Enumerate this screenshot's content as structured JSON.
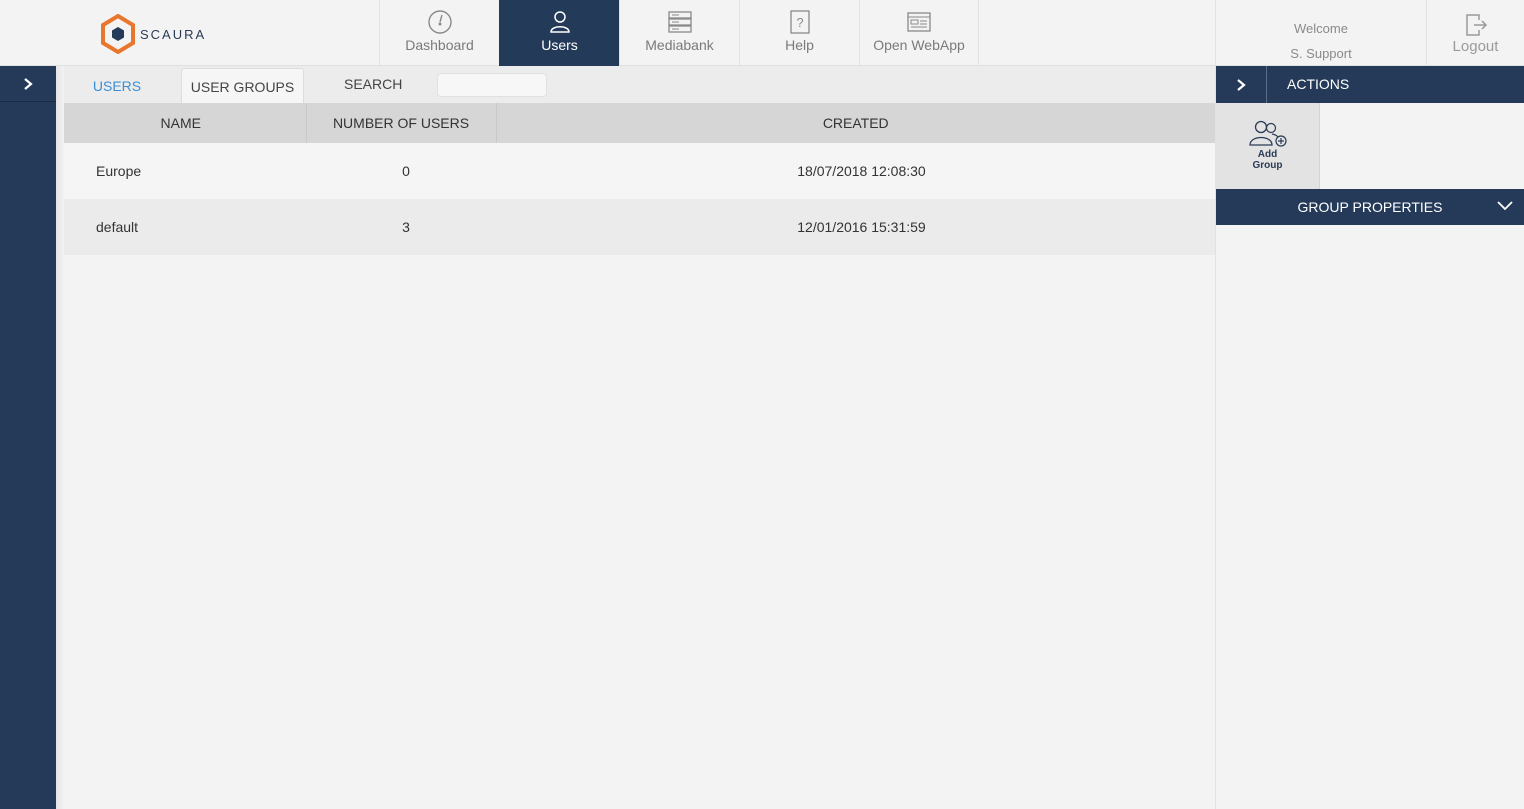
{
  "brand": {
    "name": "SCAURA"
  },
  "nav": {
    "items": [
      {
        "label": "Dashboard",
        "icon": "gauge-icon"
      },
      {
        "label": "Users",
        "icon": "user-icon"
      },
      {
        "label": "Mediabank",
        "icon": "server-icon"
      },
      {
        "label": "Help",
        "icon": "help-icon"
      },
      {
        "label": "Open WebApp",
        "icon": "browser-icon"
      }
    ],
    "active": "Users"
  },
  "user": {
    "welcome": "Welcome",
    "name": "S. Support",
    "logout_label": "Logout"
  },
  "tabs": {
    "users": "USERS",
    "user_groups": "USER GROUPS",
    "search_label": "SEARCH",
    "search_value": ""
  },
  "table": {
    "headers": [
      "NAME",
      "NUMBER OF USERS",
      "CREATED"
    ],
    "rows": [
      {
        "name": "Europe",
        "users": "0",
        "created": "18/07/2018 12:08:30"
      },
      {
        "name": "default",
        "users": "3",
        "created": "12/01/2016 15:31:59"
      }
    ]
  },
  "actions": {
    "title": "ACTIONS",
    "add_group_line1": "Add",
    "add_group_line2": "Group"
  },
  "group_properties": {
    "title": "GROUP PROPERTIES"
  },
  "colors": {
    "navy": "#243a58",
    "accent_orange": "#e8762c",
    "link_blue": "#3a8fd4"
  }
}
